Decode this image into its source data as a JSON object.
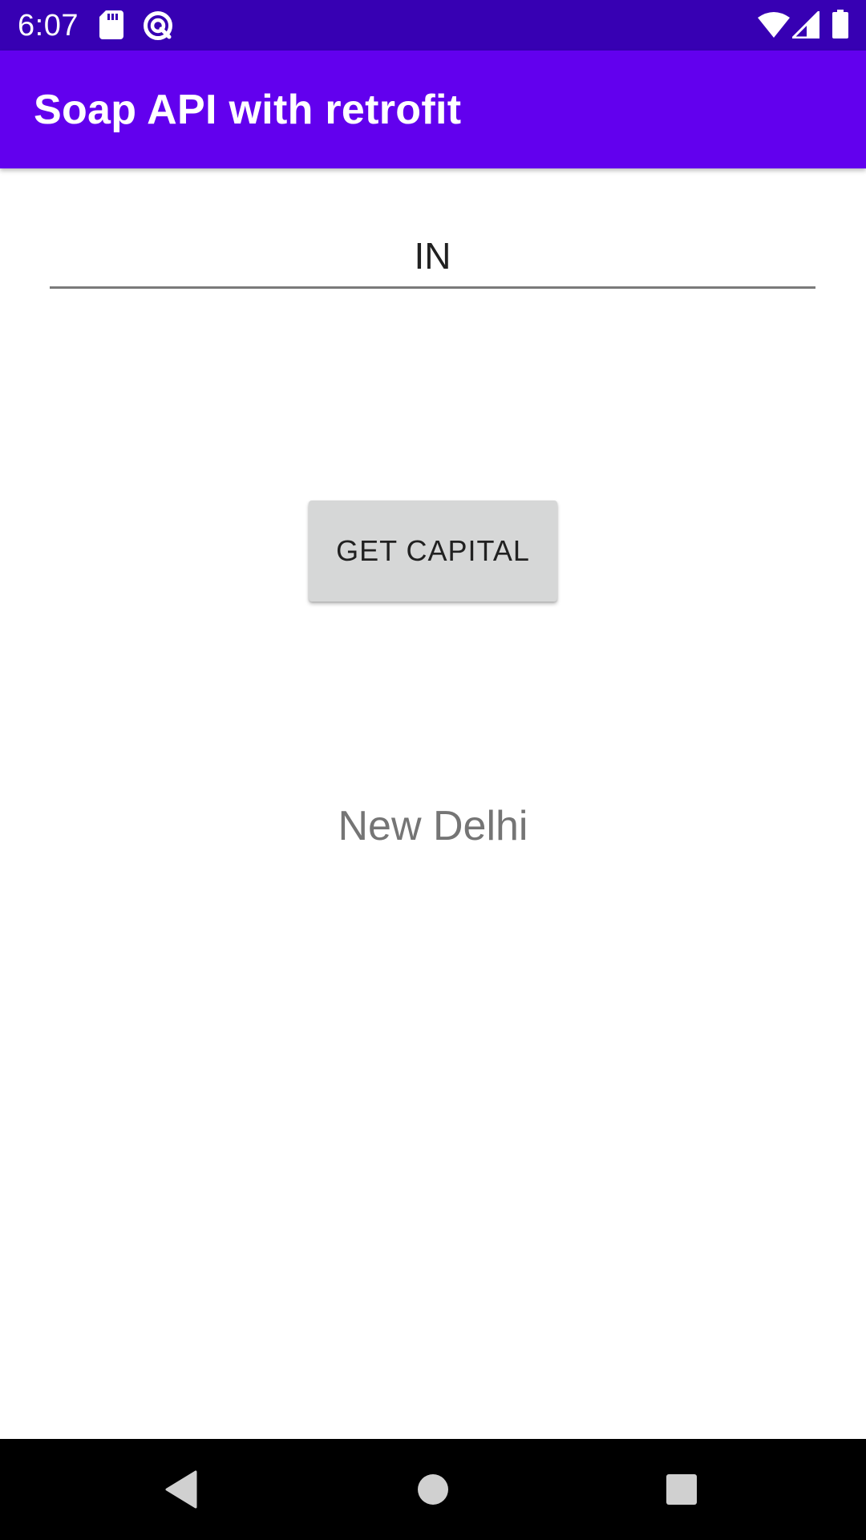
{
  "status_bar": {
    "time": "6:07",
    "icons": [
      "sd-card-icon",
      "vpn-key-icon",
      "wifi-icon",
      "cell-signal-icon",
      "battery-icon"
    ],
    "background_color": "#3700B3"
  },
  "app_bar": {
    "title": "Soap API with retrofit",
    "background_color": "#6200EE"
  },
  "main": {
    "country_input_value": "IN",
    "get_capital_label": "GET CAPITAL",
    "result_text": "New Delhi"
  },
  "nav_bar": {
    "buttons": [
      "back-icon",
      "home-icon",
      "recents-icon"
    ]
  }
}
